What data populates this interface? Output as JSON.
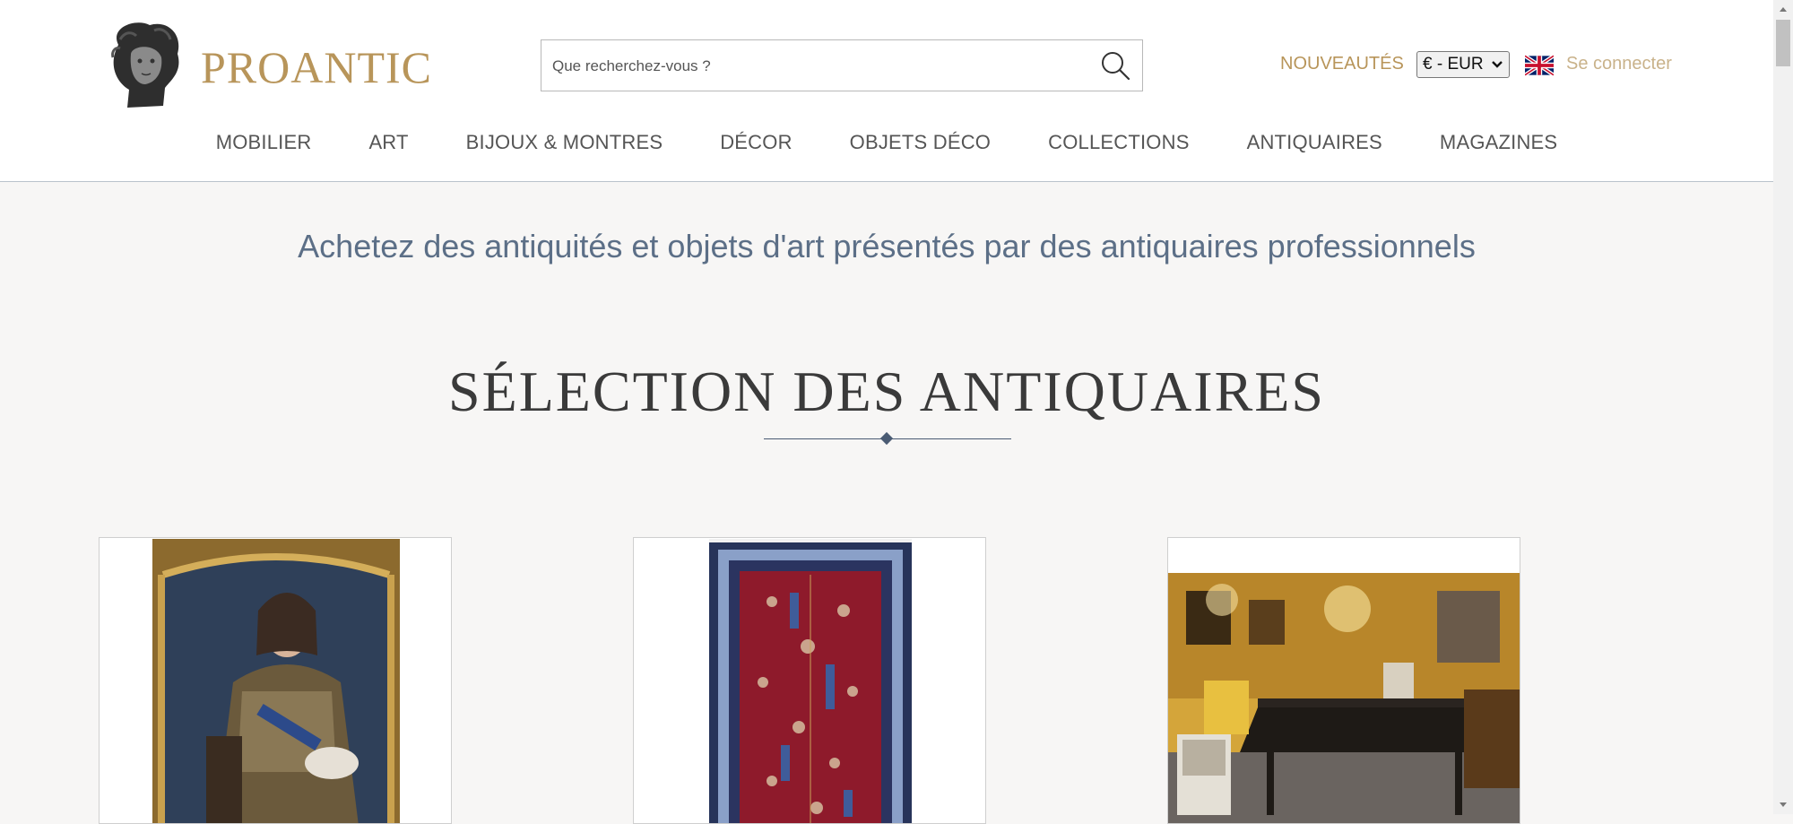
{
  "header": {
    "logo_text": "PROANTIC",
    "search_placeholder": "Que recherchez-vous ?",
    "nouveautes": "NOUVEAUTÉS",
    "currency": "€ - EUR",
    "login": "Se connecter"
  },
  "nav": {
    "items": [
      "MOBILIER",
      "ART",
      "BIJOUX & MONTRES",
      "DÉCOR",
      "OBJETS DÉCO",
      "COLLECTIONS",
      "ANTIQUAIRES",
      "MAGAZINES"
    ]
  },
  "main": {
    "tagline": "Achetez des antiquités et objets d'art présentés par des antiquaires professionnels",
    "section_title": "SÉLECTION DES ANTIQUAIRES"
  },
  "colors": {
    "gold": "#b8955a",
    "nav_text": "#555555",
    "tagline": "#5c6f87",
    "background": "#f7f6f5"
  },
  "icons": [
    "search-icon",
    "uk-flag-icon",
    "chevron-down-icon"
  ]
}
